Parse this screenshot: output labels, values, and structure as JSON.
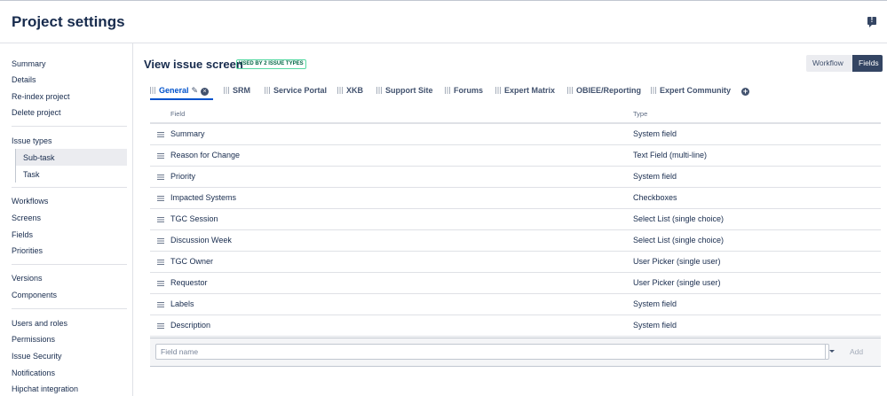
{
  "header": {
    "title": "Project settings",
    "feedback_glyph": "!"
  },
  "sidebar": {
    "items_group1": [
      "Summary",
      "Details",
      "Re-index project",
      "Delete project"
    ],
    "issue_types_label": "Issue types",
    "issue_type_children": [
      "Sub-task",
      "Task"
    ],
    "items_group2": [
      "Workflows",
      "Screens",
      "Fields",
      "Priorities"
    ],
    "items_group3": [
      "Versions",
      "Components"
    ],
    "items_group4": [
      "Users and roles",
      "Permissions",
      "Issue Security",
      "Notifications",
      "Hipchat integration"
    ]
  },
  "main": {
    "title": "View issue screen",
    "lozenge": "USED BY 2 ISSUE TYPES",
    "buttons": {
      "workflow": "Workflow",
      "fields": "Fields"
    },
    "tabs": [
      "General",
      "SRM",
      "Service Portal",
      "XKB",
      "Support Site",
      "Forums",
      "Expert Matrix",
      "OBIEE/Reporting",
      "Expert Community"
    ],
    "table": {
      "headers": {
        "field": "Field",
        "type": "Type"
      },
      "rows": [
        {
          "field": "Summary",
          "type": "System field"
        },
        {
          "field": "Reason for Change",
          "type": "Text Field (multi-line)"
        },
        {
          "field": "Priority",
          "type": "System field"
        },
        {
          "field": "Impacted Systems",
          "type": "Checkboxes"
        },
        {
          "field": "TGC Session",
          "type": "Select List (single choice)"
        },
        {
          "field": "Discussion Week",
          "type": "Select List (single choice)"
        },
        {
          "field": "TGC Owner",
          "type": "User Picker (single user)"
        },
        {
          "field": "Requestor",
          "type": "User Picker (single user)"
        },
        {
          "field": "Labels",
          "type": "System field"
        },
        {
          "field": "Description",
          "type": "System field"
        }
      ]
    },
    "add_field": {
      "placeholder": "Field name",
      "value": "",
      "add_label": "Add"
    }
  }
}
